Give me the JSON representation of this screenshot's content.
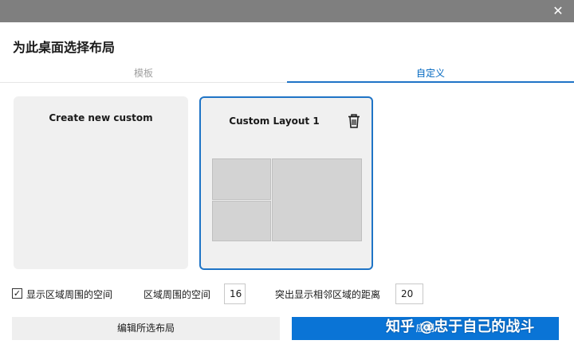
{
  "dialog": {
    "title": "为此桌面选择布局",
    "close_glyph": "✕"
  },
  "tabs": [
    {
      "label": "模板",
      "active": false
    },
    {
      "label": "自定义",
      "active": true
    }
  ],
  "cards": {
    "create_new": {
      "title": "Create new custom"
    },
    "custom_layout": {
      "title": "Custom Layout 1",
      "selected": true
    }
  },
  "options": {
    "show_space_checkbox": {
      "checked": true,
      "label": "显示区域周围的空间"
    },
    "space_around_zones": {
      "label": "区域周围的空间",
      "value": "16"
    },
    "highlight_distance": {
      "label": "突出显示相邻区域的距离",
      "value": "20"
    }
  },
  "buttons": {
    "edit_label": "编辑所选布局",
    "apply_label": "应用"
  },
  "watermark": "知乎 @忠于自己的战斗",
  "colors": {
    "accent": "#1f74c6",
    "apply_bg": "#0a74d6",
    "titlebar": "#7f7f7f",
    "card_bg": "#f0f0f0",
    "zone": "#d3d3d3"
  }
}
